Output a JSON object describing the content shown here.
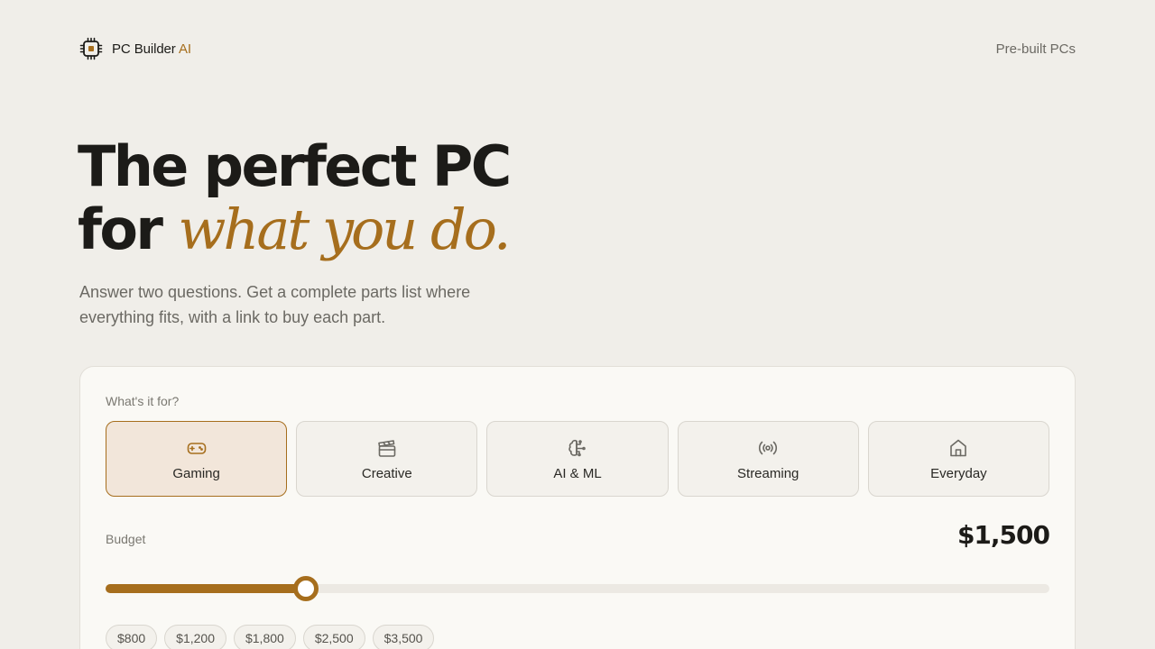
{
  "header": {
    "brand_name": "PC Builder",
    "brand_accent": "AI",
    "nav_link": "Pre-built PCs"
  },
  "hero": {
    "title_line1": "The perfect PC",
    "title_line2_prefix": "for",
    "title_line2_accent": "what you do.",
    "subtitle": "Answer two questions. Get a complete parts list where everything fits, with a link to buy each part."
  },
  "form": {
    "use_label": "What's it for?",
    "options": [
      {
        "label": "Gaming",
        "icon": "gamepad-icon",
        "selected": true
      },
      {
        "label": "Creative",
        "icon": "clapperboard-icon",
        "selected": false
      },
      {
        "label": "AI & ML",
        "icon": "brain-circuit-icon",
        "selected": false
      },
      {
        "label": "Streaming",
        "icon": "radio-broadcast-icon",
        "selected": false
      },
      {
        "label": "Everyday",
        "icon": "home-icon",
        "selected": false
      }
    ],
    "budget_label": "Budget",
    "budget_value": "$1,500",
    "budget_fill_fraction": 0.212,
    "presets": [
      "$800",
      "$1,200",
      "$1,800",
      "$2,500",
      "$3,500"
    ]
  },
  "colors": {
    "accent": "#a66e1d",
    "background": "#f0eee9",
    "card": "#faf9f5",
    "selected_bg": "#f2e6da"
  }
}
